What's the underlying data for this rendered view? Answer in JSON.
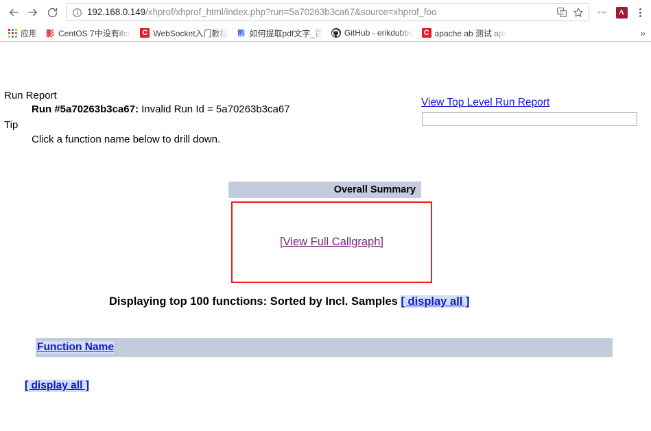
{
  "browser": {
    "nav": {
      "back_label": "Back",
      "forward_label": "Forward",
      "reload_label": "Reload"
    },
    "omnibox": {
      "info_icon": "info-circle-icon",
      "url_host": "192.168.0.149",
      "url_path": "/xhprof/xhprof_html/index.php?run=5a70263b3ca67&source=xhprof_foo",
      "url_full": "192.168.0.149/xhprof/xhprof_html/index.php?run=5a70263b3ca67&source=xhprof_foo",
      "translate_icon": "translate-icon",
      "bookmark_icon": "star-icon"
    },
    "toolbar_icons": [
      {
        "name": "extension-icon",
        "glyph": "••"
      },
      {
        "name": "pdf-extension-icon",
        "glyph": "A"
      }
    ],
    "menu_icon": "three-dot-menu-icon",
    "bookmarks": {
      "apps_label": "应用",
      "apps_icon": "apps-grid-icon",
      "overflow_label": "»",
      "items": [
        {
          "label": "CentOS 7中没有ifco",
          "icon": "red-glyph-favicon",
          "glyph": "影"
        },
        {
          "label": "WebSocket入门教程",
          "icon": "c-favicon",
          "glyph": "C"
        },
        {
          "label": "如何提取pdf文字_百",
          "icon": "baidu-favicon",
          "glyph": "熊"
        },
        {
          "label": "GitHub - erikdubbe",
          "icon": "github-favicon",
          "glyph": "●"
        },
        {
          "label": "apache ab 测试 apr",
          "icon": "c-favicon",
          "glyph": "C"
        }
      ]
    }
  },
  "page": {
    "run_report_title": "Run Report",
    "run_label": "Run #5a70263b3ca67:",
    "run_message": " Invalid Run Id = 5a70263b3ca67",
    "tip_title": "Tip",
    "tip_text": "Click a function name below to drill down.",
    "top_level_link": "View Top Level Run Report",
    "search_placeholder": "",
    "search_value": "",
    "overall_summary_label": "Overall Summary",
    "callgraph_link": "[View Full Callgraph]",
    "displaying_text": "Displaying top 100 functions: Sorted by Incl. Samples ",
    "display_all_top": "[ display all ]",
    "table_header_function_name": "Function Name",
    "table_rows": [],
    "display_all_bottom": "[ display all ]"
  },
  "colors": {
    "link_blue": "#1414cc",
    "link_visited_purple": "#7a2a7a",
    "header_bar": "#c3cbdc",
    "callgraph_border_red": "#f21b1b",
    "selection_highlight": "#cfe0f7"
  }
}
